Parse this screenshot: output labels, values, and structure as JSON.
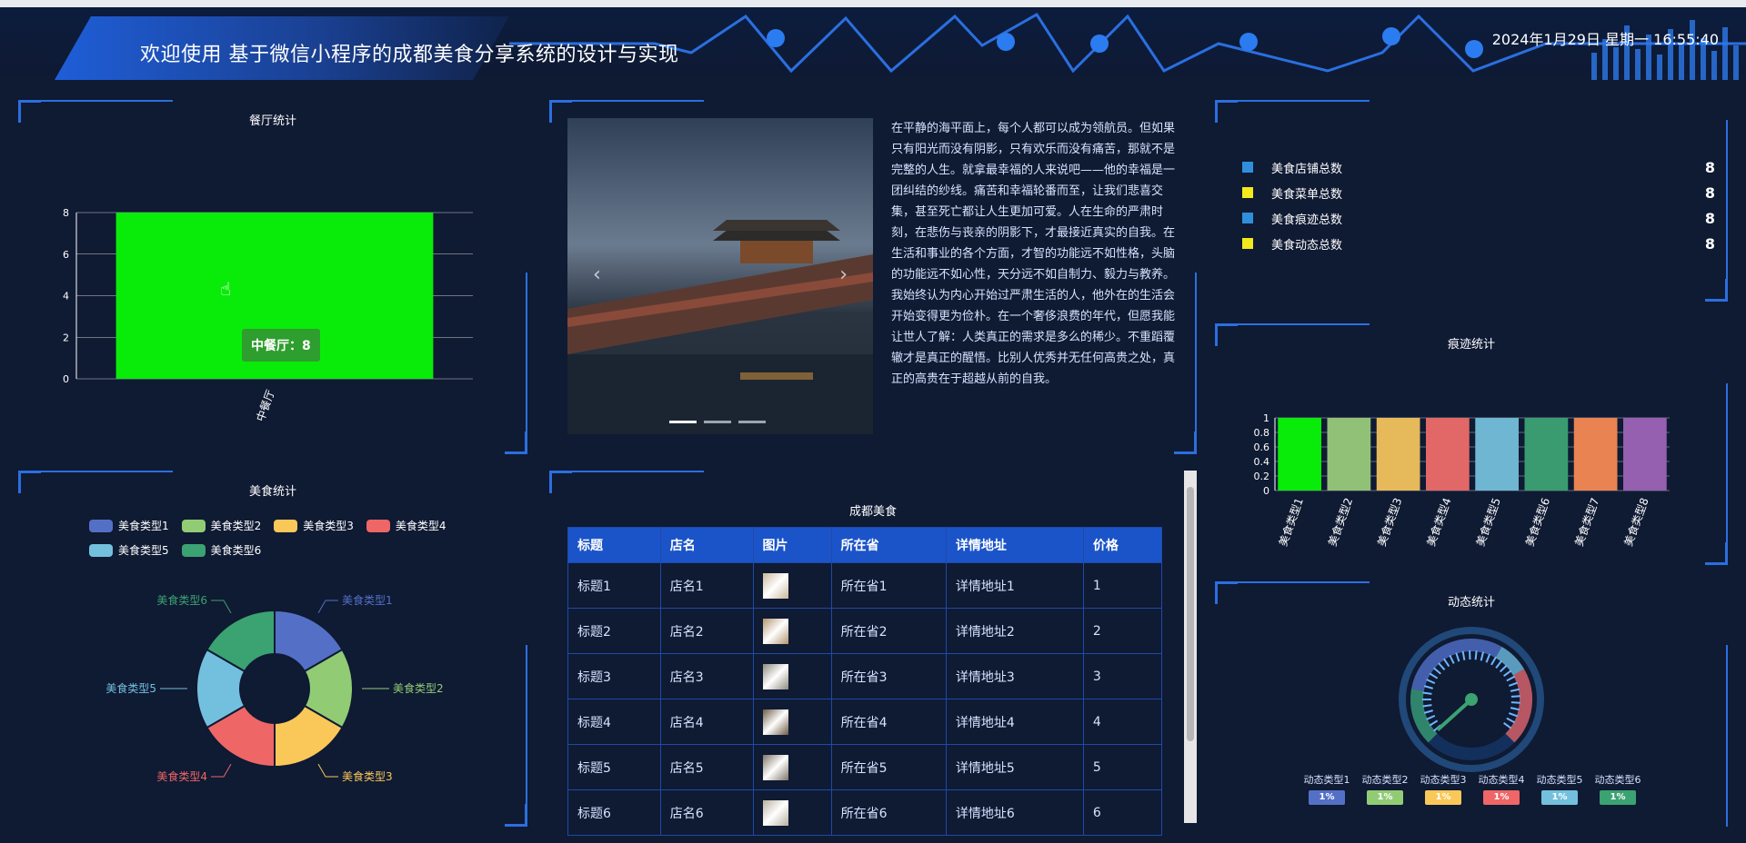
{
  "header": {
    "title": "欢迎使用 基于微信小程序的成都美食分享系统的设计与实现",
    "datetime": "2024年1月29日 星期一 16:55:40"
  },
  "restaurant": {
    "title": "餐厅统计",
    "tooltip": "中餐厅：8",
    "chart_data": {
      "type": "bar",
      "title": "餐厅统计",
      "categories": [
        "中餐厅"
      ],
      "values": [
        8
      ],
      "ylim": [
        0,
        8
      ],
      "yticks": [
        0,
        2,
        4,
        6,
        8
      ],
      "color": "#09ec09"
    }
  },
  "food": {
    "title": "美食统计",
    "chart_data": {
      "type": "pie",
      "title": "美食统计",
      "categories": [
        "美食类型1",
        "美食类型2",
        "美食类型3",
        "美食类型4",
        "美食类型5",
        "美食类型6"
      ],
      "values": [
        1,
        1,
        1,
        1,
        1,
        1
      ],
      "colors": [
        "#5470c6",
        "#91cc75",
        "#fac858",
        "#ee6666",
        "#73c0de",
        "#3ba272"
      ]
    }
  },
  "carousel": {
    "prev_icon": "‹",
    "next_icon": "›",
    "text": "在平静的海平面上，每个人都可以成为领航员。但如果只有阳光而没有阴影，只有欢乐而没有痛苦，那就不是完整的人生。就拿最幸福的人来说吧——他的幸福是一团纠结的纱线。痛苦和幸福轮番而至，让我们悲喜交集，甚至死亡都让人生更加可爱。人在生命的严肃时刻，在悲伤与丧亲的阴影下，才最接近真实的自我。在生活和事业的各个方面，才智的功能远不如性格，头脑的功能远不如心性，天分远不如自制力、毅力与教养。我始终认为内心开始过严肃生活的人，他外在的生活会开始变得更为俭朴。在一个奢侈浪费的年代，但愿我能让世人了解：人类真正的需求是多么的稀少。不重蹈覆辙才是真正的醒悟。比别人优秀并无任何高贵之处，真正的高贵在于超越从前的自我。"
  },
  "table": {
    "title": "成都美食",
    "columns": [
      "标题",
      "店名",
      "图片",
      "所在省",
      "详情地址",
      "价格"
    ],
    "rows": [
      [
        "标题1",
        "店名1",
        "",
        "所在省1",
        "详情地址1",
        "1"
      ],
      [
        "标题2",
        "店名2",
        "",
        "所在省2",
        "详情地址2",
        "2"
      ],
      [
        "标题3",
        "店名3",
        "",
        "所在省3",
        "详情地址3",
        "3"
      ],
      [
        "标题4",
        "店名4",
        "",
        "所在省4",
        "详情地址4",
        "4"
      ],
      [
        "标题5",
        "店名5",
        "",
        "所在省5",
        "详情地址5",
        "5"
      ],
      [
        "标题6",
        "店名6",
        "",
        "所在省6",
        "详情地址6",
        "6"
      ]
    ]
  },
  "totals": {
    "items": [
      {
        "label": "美食店铺总数",
        "value": "8",
        "color": "#2f8fdd"
      },
      {
        "label": "美食菜单总数",
        "value": "8",
        "color": "#f2ea1b"
      },
      {
        "label": "美食痕迹总数",
        "value": "8",
        "color": "#2f8fdd"
      },
      {
        "label": "美食动态总数",
        "value": "8",
        "color": "#f2ea1b"
      }
    ]
  },
  "trace": {
    "title": "痕迹统计",
    "chart_data": {
      "type": "bar",
      "title": "痕迹统计",
      "categories": [
        "美食类型1",
        "美食类型2",
        "美食类型3",
        "美食类型4",
        "美食类型5",
        "美食类型6",
        "美食类型7",
        "美食类型8"
      ],
      "values": [
        1,
        1,
        1,
        1,
        1,
        1,
        1,
        1
      ],
      "ylim": [
        0,
        1
      ],
      "yticks": [
        0,
        0.2,
        0.4,
        0.6,
        0.8,
        1
      ],
      "colors": [
        "#09ec09",
        "#91c176",
        "#e6b95a",
        "#e26767",
        "#6fb6d2",
        "#3a9b70",
        "#e98351",
        "#9560b0"
      ]
    }
  },
  "dynamic": {
    "title": "动态统计",
    "chart_data": {
      "type": "gauge",
      "title": "动态统计",
      "categories": [
        "动态类型1",
        "动态类型2",
        "动态类型3",
        "动态类型4",
        "动态类型5",
        "动态类型6"
      ],
      "values": [
        "1%",
        "1%",
        "1%",
        "1%",
        "1%",
        "1%"
      ],
      "colors": [
        "#5470c6",
        "#91cc75",
        "#fac858",
        "#ee6666",
        "#73c0de",
        "#3ba272"
      ]
    }
  }
}
